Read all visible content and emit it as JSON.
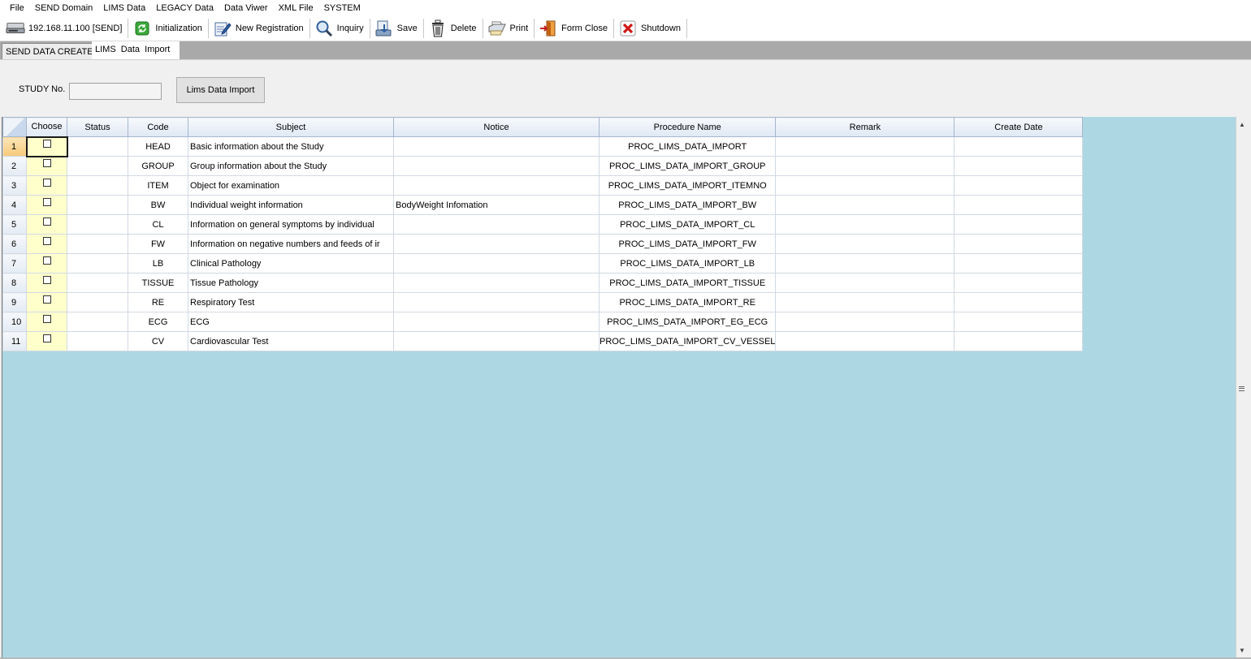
{
  "menu": [
    "File",
    "SEND Domain",
    "LIMS Data",
    "LEGACY Data",
    "Data Viwer",
    "XML File",
    "SYSTEM"
  ],
  "toolbar": {
    "server": "192.168.11.100 [SEND]",
    "initialization": "Initialization",
    "new_registration": "New Registration",
    "inquiry": "Inquiry",
    "save": "Save",
    "delete": "Delete",
    "print": "Print",
    "form_close": "Form Close",
    "shutdown": "Shutdown"
  },
  "tabs": [
    "SEND DATA CREATE",
    "LIMS  Data  Import"
  ],
  "search": {
    "study_label": "STUDY No.",
    "study_value": "",
    "import_button": "Lims Data Import"
  },
  "grid": {
    "columns": [
      "Choose",
      "Status",
      "Code",
      "Subject",
      "Notice",
      "Procedure Name",
      "Remark",
      "Create Date"
    ],
    "rows": [
      {
        "num": "1",
        "status": "",
        "code": "HEAD",
        "subject": "Basic information about the Study",
        "notice": "",
        "procedure": "PROC_LIMS_DATA_IMPORT",
        "remark": "",
        "date": ""
      },
      {
        "num": "2",
        "status": "",
        "code": "GROUP",
        "subject": "Group information about the Study",
        "notice": "",
        "procedure": "PROC_LIMS_DATA_IMPORT_GROUP",
        "remark": "",
        "date": ""
      },
      {
        "num": "3",
        "status": "",
        "code": "ITEM",
        "subject": "Object for examination",
        "notice": "",
        "procedure": "PROC_LIMS_DATA_IMPORT_ITEMNO",
        "remark": "",
        "date": ""
      },
      {
        "num": "4",
        "status": "",
        "code": "BW",
        "subject": "Individual weight information",
        "notice": "BodyWeight Infomation",
        "procedure": "PROC_LIMS_DATA_IMPORT_BW",
        "remark": "",
        "date": ""
      },
      {
        "num": "5",
        "status": "",
        "code": "CL",
        "subject": "Information on general symptoms by individual",
        "notice": "",
        "procedure": "PROC_LIMS_DATA_IMPORT_CL",
        "remark": "",
        "date": ""
      },
      {
        "num": "6",
        "status": "",
        "code": "FW",
        "subject": "Information on negative numbers and feeds of ir",
        "notice": "",
        "procedure": "PROC_LIMS_DATA_IMPORT_FW",
        "remark": "",
        "date": ""
      },
      {
        "num": "7",
        "status": "",
        "code": "LB",
        "subject": "Clinical Pathology",
        "notice": "",
        "procedure": "PROC_LIMS_DATA_IMPORT_LB",
        "remark": "",
        "date": ""
      },
      {
        "num": "8",
        "status": "",
        "code": "TISSUE",
        "subject": "Tissue Pathology",
        "notice": "",
        "procedure": "PROC_LIMS_DATA_IMPORT_TISSUE",
        "remark": "",
        "date": ""
      },
      {
        "num": "9",
        "status": "",
        "code": "RE",
        "subject": "Respiratory Test",
        "notice": "",
        "procedure": "PROC_LIMS_DATA_IMPORT_RE",
        "remark": "",
        "date": ""
      },
      {
        "num": "10",
        "status": "",
        "code": "ECG",
        "subject": "ECG",
        "notice": "",
        "procedure": "PROC_LIMS_DATA_IMPORT_EG_ECG",
        "remark": "",
        "date": ""
      },
      {
        "num": "11",
        "status": "",
        "code": "CV",
        "subject": "Cardiovascular Test",
        "notice": "",
        "procedure": "PROC_LIMS_DATA_IMPORT_CV_VESSEL",
        "remark": "",
        "date": ""
      }
    ]
  },
  "colors": {
    "grid_background": "#add8e3",
    "choose_column": "#ffffcc",
    "selected_rownum": "#f6c97a"
  }
}
